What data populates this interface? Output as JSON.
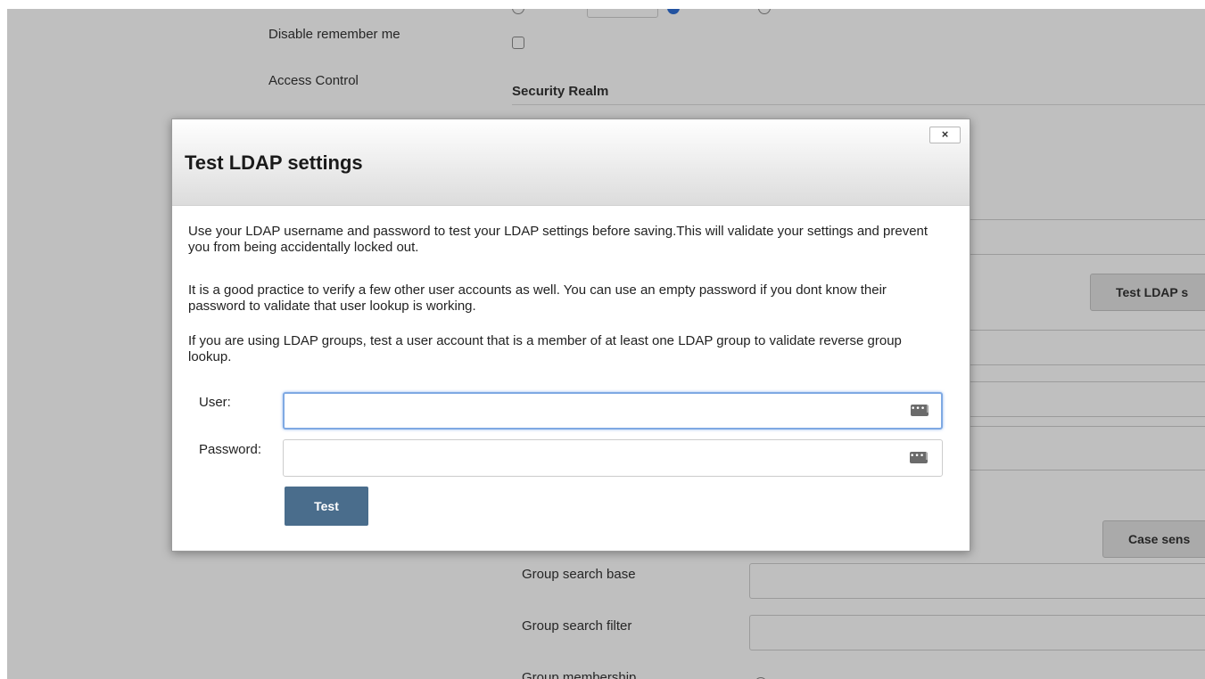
{
  "settings": {
    "disable_remember_me_label": "Disable remember me",
    "access_control_label": "Access Control",
    "security_realm_heading": "Security Realm",
    "test_ldap_button": "Test LDAP s",
    "case_sensitive_button": "Case sens",
    "group_search_base_label": "Group search base",
    "group_search_filter_label": "Group search filter",
    "group_membership_label": "Group membership"
  },
  "modal": {
    "title": "Test LDAP settings",
    "close_label": "×",
    "paragraphs": [
      "Use your LDAP username and password to test your LDAP settings before saving.This will validate your settings and prevent you from being accidentally locked out.",
      "It is a good practice to verify a few other user accounts as well. You can use an empty password if you dont know their password to validate that user lookup is working.",
      "If you are using LDAP groups, test a user account that is a member of at least one LDAP group to validate reverse group lookup."
    ],
    "user_label": "User:",
    "user_value": "",
    "password_label": "Password:",
    "password_value": "",
    "keychain_icon_glyph": "•••|",
    "test_button": "Test"
  },
  "colors": {
    "primary_button": "#4a6d8c",
    "focus_ring": "#7fa9e3",
    "overlay": "rgba(0,0,0,0.25)"
  }
}
